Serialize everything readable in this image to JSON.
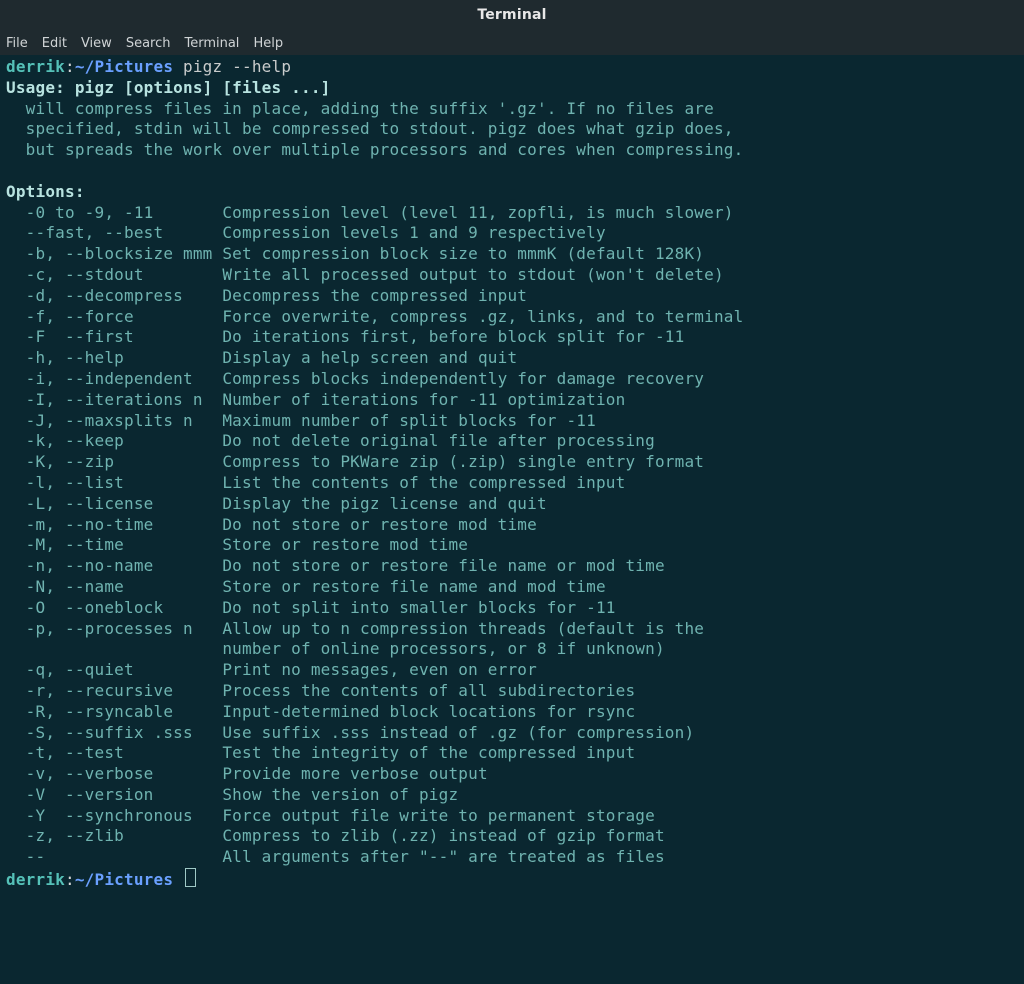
{
  "window": {
    "title": "Terminal"
  },
  "menubar": [
    "File",
    "Edit",
    "View",
    "Search",
    "Terminal",
    "Help"
  ],
  "prompt": {
    "user": "derrik",
    "sep1": ":",
    "path": "~/Pictures",
    "command": "pigz --help"
  },
  "usage_line": "Usage: pigz [options] [files ...]",
  "desc_lines": [
    "  will compress files in place, adding the suffix '.gz'. If no files are",
    "  specified, stdin will be compressed to stdout. pigz does what gzip does,",
    "  but spreads the work over multiple processors and cores when compressing."
  ],
  "options_header": "Options:",
  "options": [
    {
      "flag": "-0 to -9, -11",
      "desc": "Compression level (level 11, zopfli, is much slower)"
    },
    {
      "flag": "--fast, --best",
      "desc": "Compression levels 1 and 9 respectively"
    },
    {
      "flag": "-b, --blocksize mmm",
      "desc": "Set compression block size to mmmK (default 128K)"
    },
    {
      "flag": "-c, --stdout",
      "desc": "Write all processed output to stdout (won't delete)"
    },
    {
      "flag": "-d, --decompress",
      "desc": "Decompress the compressed input"
    },
    {
      "flag": "-f, --force",
      "desc": "Force overwrite, compress .gz, links, and to terminal"
    },
    {
      "flag": "-F  --first",
      "desc": "Do iterations first, before block split for -11"
    },
    {
      "flag": "-h, --help",
      "desc": "Display a help screen and quit"
    },
    {
      "flag": "-i, --independent",
      "desc": "Compress blocks independently for damage recovery"
    },
    {
      "flag": "-I, --iterations n",
      "desc": "Number of iterations for -11 optimization"
    },
    {
      "flag": "-J, --maxsplits n",
      "desc": "Maximum number of split blocks for -11"
    },
    {
      "flag": "-k, --keep",
      "desc": "Do not delete original file after processing"
    },
    {
      "flag": "-K, --zip",
      "desc": "Compress to PKWare zip (.zip) single entry format"
    },
    {
      "flag": "-l, --list",
      "desc": "List the contents of the compressed input"
    },
    {
      "flag": "-L, --license",
      "desc": "Display the pigz license and quit"
    },
    {
      "flag": "-m, --no-time",
      "desc": "Do not store or restore mod time"
    },
    {
      "flag": "-M, --time",
      "desc": "Store or restore mod time"
    },
    {
      "flag": "-n, --no-name",
      "desc": "Do not store or restore file name or mod time"
    },
    {
      "flag": "-N, --name",
      "desc": "Store or restore file name and mod time"
    },
    {
      "flag": "-O  --oneblock",
      "desc": "Do not split into smaller blocks for -11"
    },
    {
      "flag": "-p, --processes n",
      "desc": "Allow up to n compression threads (default is the"
    },
    {
      "flag": "",
      "desc": "number of online processors, or 8 if unknown)"
    },
    {
      "flag": "-q, --quiet",
      "desc": "Print no messages, even on error"
    },
    {
      "flag": "-r, --recursive",
      "desc": "Process the contents of all subdirectories"
    },
    {
      "flag": "-R, --rsyncable",
      "desc": "Input-determined block locations for rsync"
    },
    {
      "flag": "-S, --suffix .sss",
      "desc": "Use suffix .sss instead of .gz (for compression)"
    },
    {
      "flag": "-t, --test",
      "desc": "Test the integrity of the compressed input"
    },
    {
      "flag": "-v, --verbose",
      "desc": "Provide more verbose output"
    },
    {
      "flag": "-V  --version",
      "desc": "Show the version of pigz"
    },
    {
      "flag": "-Y  --synchronous",
      "desc": "Force output file write to permanent storage"
    },
    {
      "flag": "-z, --zlib",
      "desc": "Compress to zlib (.zz) instead of gzip format"
    },
    {
      "flag": "--",
      "desc": "All arguments after \"--\" are treated as files"
    }
  ],
  "prompt2": {
    "user": "derrik",
    "sep1": ":",
    "path": "~/Pictures"
  }
}
